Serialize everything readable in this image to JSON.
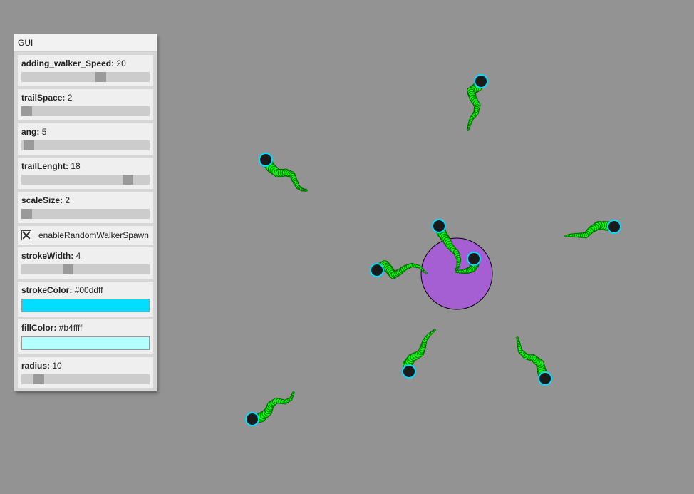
{
  "gui": {
    "title": "GUI",
    "controls": [
      {
        "type": "slider",
        "name": "adding_walker_Speed",
        "label": "adding_walker_Speed:",
        "value": "20",
        "level": 0.63
      },
      {
        "type": "slider",
        "name": "trailSpace",
        "label": "trailSpace:",
        "value": "2",
        "level": 0.0
      },
      {
        "type": "slider",
        "name": "ang",
        "label": "ang:",
        "value": "5",
        "level": 0.02
      },
      {
        "type": "slider",
        "name": "trailLenght",
        "label": "trailLenght:",
        "value": "18",
        "level": 0.86
      },
      {
        "type": "slider",
        "name": "scaleSize",
        "label": "scaleSize:",
        "value": "2",
        "level": 0.0
      },
      {
        "type": "checkbox",
        "name": "enableRandomWalkerSpawn",
        "label": "enableRandomWalkerSpawn",
        "checked": true
      },
      {
        "type": "slider",
        "name": "strokeWidth",
        "label": "strokeWidth:",
        "value": "4",
        "level": 0.35
      },
      {
        "type": "color",
        "name": "strokeColor",
        "label": "strokeColor:",
        "value": "#00ddff"
      },
      {
        "type": "color",
        "name": "fillColor",
        "label": "fillColor:",
        "value": "#b4ffff"
      },
      {
        "type": "slider",
        "name": "radius",
        "label": "radius:",
        "value": "10",
        "level": 0.1
      }
    ]
  },
  "canvas": {
    "background": "#939393",
    "center_circle_color": "#a65ed3",
    "trail_color": "#00ff00",
    "trail_outline_color": "#006600",
    "walker_head_color": "#1a1a1a",
    "walker_outline_color": "#00ddff",
    "walker_count": 9
  }
}
